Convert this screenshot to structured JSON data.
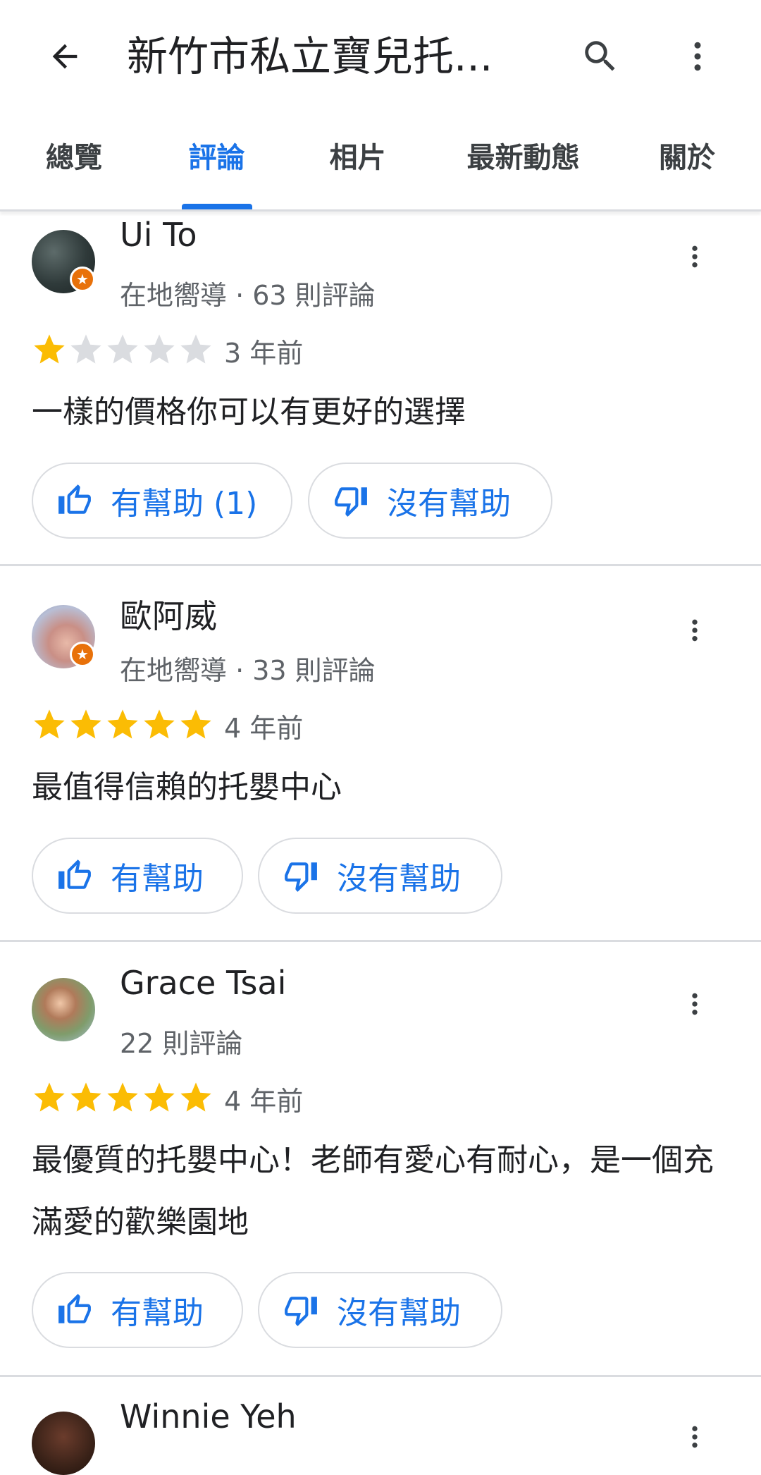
{
  "appbar": {
    "title": "新竹市私立寶兒托...",
    "back_icon": "arrow-back-icon",
    "search_icon": "search-icon",
    "more_icon": "more-vert-icon"
  },
  "tabs": [
    {
      "label": "總覽",
      "active": false
    },
    {
      "label": "評論",
      "active": true
    },
    {
      "label": "相片",
      "active": false
    },
    {
      "label": "最新動態",
      "active": false
    },
    {
      "label": "關於",
      "active": false
    }
  ],
  "colors": {
    "accent": "#1a73e8",
    "star_filled": "#fbbc04",
    "star_empty": "#dadce0",
    "local_guide_badge": "#e8710a"
  },
  "reviews": [
    {
      "name": "Ui To",
      "meta": "在地嚮導 · 63 則評論",
      "local_guide": true,
      "rating": 1,
      "date": "3 年前",
      "text": "一樣的價格你可以有更好的選擇",
      "helpful_label": "有幫助 (1)",
      "not_helpful_label": "沒有幫助"
    },
    {
      "name": "歐阿威",
      "meta": "在地嚮導 · 33 則評論",
      "local_guide": true,
      "rating": 5,
      "date": "4 年前",
      "text": "最值得信賴的托嬰中心",
      "helpful_label": "有幫助",
      "not_helpful_label": "沒有幫助"
    },
    {
      "name": "Grace Tsai",
      "meta": "22 則評論",
      "local_guide": false,
      "rating": 5,
      "date": "4 年前",
      "text": "最優質的托嬰中心！老師有愛心有耐心，是一個充滿愛的歡樂園地",
      "helpful_label": "有幫助",
      "not_helpful_label": "沒有幫助"
    },
    {
      "name": "Winnie Yeh"
    }
  ]
}
